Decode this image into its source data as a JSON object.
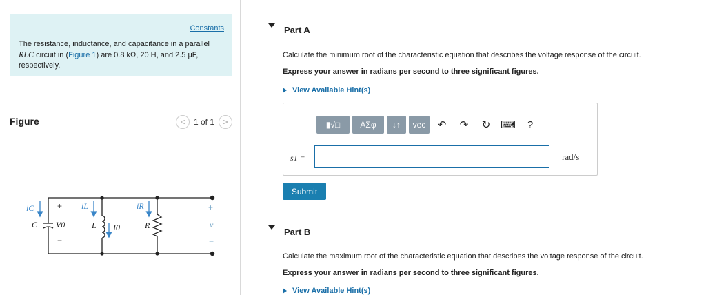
{
  "left": {
    "constants_link": "Constants",
    "info": {
      "line1": "The resistance, inductance, and capacitance in a parallel",
      "rlc": "RLC",
      "line2a": " circuit in (",
      "figure_link": "Figure 1",
      "line2b": ") are 0.8 kΩ, 20 H, and 2.5 μF,",
      "line3": "respectively."
    },
    "figure": {
      "title": "Figure",
      "page": "1 of 1",
      "prev": "<",
      "next": ">"
    },
    "circuit": {
      "ic": "iC",
      "il": "iL",
      "ir": "iR",
      "C": "C",
      "V0": "V0",
      "L": "L",
      "I0": "I0",
      "R": "R",
      "plus": "+",
      "minus": "−",
      "v": "v"
    }
  },
  "partA": {
    "label": "Part A",
    "question": "Calculate the minimum root of the characteristic equation that describes the voltage response of the circuit.",
    "instruction": "Express your answer in radians per second to three significant figures.",
    "hint": "View Available Hint(s)",
    "toolbar": {
      "templates": "▮√□",
      "greek": "ΑΣφ",
      "updown": "↓↑",
      "vec": "vec",
      "undo": "↶",
      "redo": "↷",
      "reset": "↻",
      "keyboard": "⌨",
      "help": "?"
    },
    "var_label": "s1 =",
    "input_value": "",
    "unit": "rad/s",
    "submit": "Submit"
  },
  "partB": {
    "label": "Part B",
    "question": "Calculate the maximum root of the characteristic equation that describes the voltage response of the circuit.",
    "instruction": "Express your answer in radians per second to three significant figures.",
    "hint": "View Available Hint(s)"
  }
}
